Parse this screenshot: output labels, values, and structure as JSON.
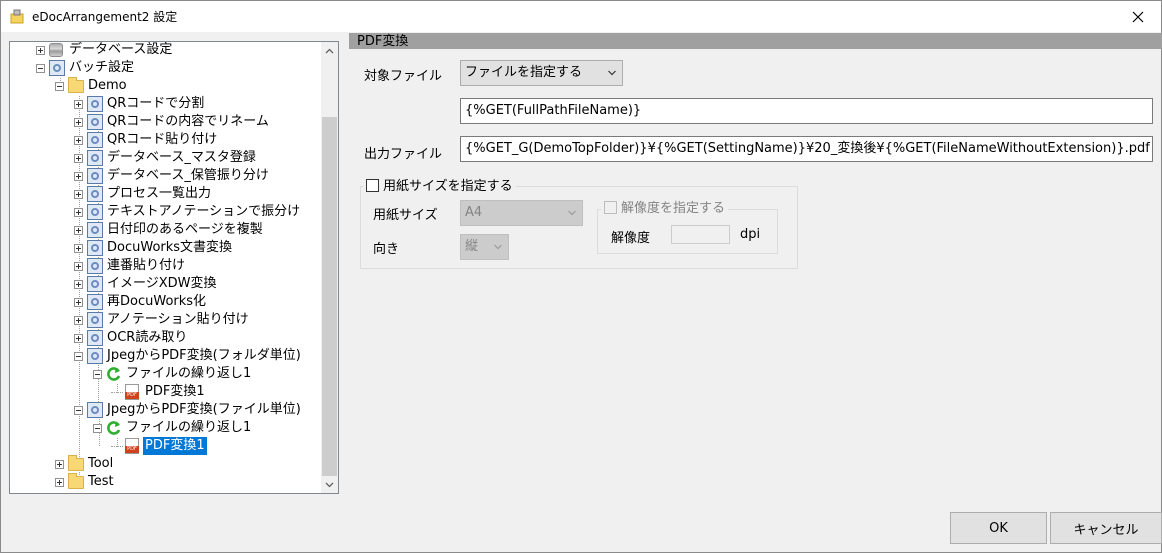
{
  "window": {
    "title": "eDocArrangement2 設定"
  },
  "tree": {
    "items": [
      {
        "label": "データベース設定",
        "icon": "database-icon"
      },
      {
        "label": "バッチ設定",
        "icon": "gear-icon"
      },
      {
        "label": "Demo",
        "icon": "folder-icon"
      },
      {
        "label": "QRコードで分割",
        "icon": "gear-icon"
      },
      {
        "label": "QRコードの内容でリネーム",
        "icon": "gear-icon"
      },
      {
        "label": "QRコード貼り付け",
        "icon": "gear-icon"
      },
      {
        "label": "データベース_マスタ登録",
        "icon": "gear-icon"
      },
      {
        "label": "データベース_保管振り分け",
        "icon": "gear-icon"
      },
      {
        "label": "プロセス一覧出力",
        "icon": "gear-icon"
      },
      {
        "label": "テキストアノテーションで振分け",
        "icon": "gear-icon"
      },
      {
        "label": "日付印のあるページを複製",
        "icon": "gear-icon"
      },
      {
        "label": "DocuWorks文書変換",
        "icon": "gear-icon"
      },
      {
        "label": "連番貼り付け",
        "icon": "gear-icon"
      },
      {
        "label": "イメージXDW変換",
        "icon": "gear-icon"
      },
      {
        "label": "再DocuWorks化",
        "icon": "gear-icon"
      },
      {
        "label": "アノテーション貼り付け",
        "icon": "gear-icon"
      },
      {
        "label": "OCR読み取り",
        "icon": "gear-icon"
      },
      {
        "label": "JpegからPDF変換(フォルダ単位)",
        "icon": "gear-icon"
      },
      {
        "label": "ファイルの繰り返し1",
        "icon": "loop-icon"
      },
      {
        "label": "PDF変換1",
        "icon": "pdf-icon"
      },
      {
        "label": "JpegからPDF変換(ファイル単位)",
        "icon": "gear-icon"
      },
      {
        "label": "ファイルの繰り返し1",
        "icon": "loop-icon"
      },
      {
        "label": "PDF変換1",
        "icon": "pdf-icon",
        "selected": true
      },
      {
        "label": "Tool",
        "icon": "folder-icon"
      },
      {
        "label": "Test",
        "icon": "folder-icon"
      }
    ]
  },
  "panel": {
    "header": "PDF変換",
    "target_label": "対象ファイル",
    "target_mode": "ファイルを指定する",
    "target_value": "{%GET(FullPathFileName)}",
    "output_label": "出力ファイル",
    "output_value": "{%GET_G(DemoTopFolder)}¥{%GET(SettingName)}¥20_変換後¥{%GET(FileNameWithoutExtension)}.pdf",
    "paper_group": {
      "checkbox_label": "用紙サイズを指定する",
      "checked": false,
      "size_label": "用紙サイズ",
      "size_value": "A4",
      "orientation_label": "向き",
      "orientation_value": "縦",
      "resolution_group": {
        "checkbox_label": "解像度を指定する",
        "resolution_label": "解像度",
        "resolution_value": "",
        "unit": "dpi"
      }
    }
  },
  "buttons": {
    "ok": "OK",
    "cancel": "キャンセル"
  }
}
